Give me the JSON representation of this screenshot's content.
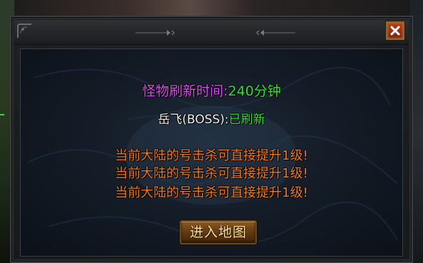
{
  "dialog": {
    "close_icon": "close-x-icon",
    "refresh_timer": {
      "label": "怪物刷新时间:",
      "value": "240分钟",
      "label_color": "#d94cf0",
      "value_color": "#36e03a"
    },
    "boss_status": {
      "name": "岳飞(BOSS):",
      "status": "已刷新",
      "name_color": "#f2f2f2",
      "status_color": "#36e03a"
    },
    "notices": [
      "当前大陆的号击杀可直接提升1级!",
      "当前大陆的号击杀可直接提升1级!",
      "当前大陆的号击杀可直接提升1级!"
    ],
    "notice_color": "#ee7a1e",
    "enter_button_label": "进入地图"
  }
}
